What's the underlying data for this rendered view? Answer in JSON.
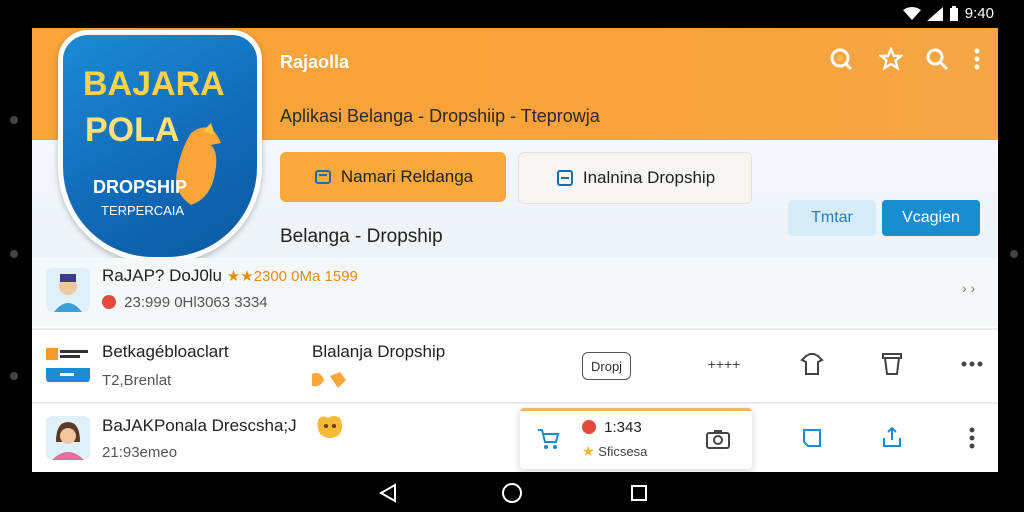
{
  "status_bar": {
    "time": "9:40"
  },
  "app_bar": {
    "title": "Rajaolla",
    "subtitle": "Aplikasi Belanga - Dropshiip - Tteprowja",
    "icons": [
      "lens-icon",
      "star-outline-icon",
      "search-icon",
      "more-vert-icon"
    ]
  },
  "logo": {
    "line1": "BAJARA",
    "line2": "POLA",
    "line3": "DROPSHIP",
    "line4": "TERPERCAIA"
  },
  "buttons": {
    "primary_pill": "Namari Reldanga",
    "secondary_pill": "Inalnina Dropship",
    "small_light": "Tmtar",
    "small_blue": "Vcagien"
  },
  "section_title": "Belanga - Dropship",
  "rows": [
    {
      "title": "RaJAP? DoJ0lu",
      "rating": "★★2300 0Ma 1599",
      "sub": "23:999 0Hl3063 3334",
      "trailing": "› ›"
    },
    {
      "title": "Betkagébloaclart",
      "mid_title": "Blalanja Dropship",
      "sub": "T2,Brenlat",
      "chip": "Dropj",
      "dots": "++++"
    },
    {
      "title": "BaJAKPonala Drescsha;J",
      "sub": "21:93emeo",
      "popup_line1": "1:343",
      "popup_line2": "Sficsesa"
    }
  ],
  "colors": {
    "accent_orange": "#f9a53a",
    "accent_blue": "#1a8cd0",
    "light_blue": "#d7ebf7"
  }
}
